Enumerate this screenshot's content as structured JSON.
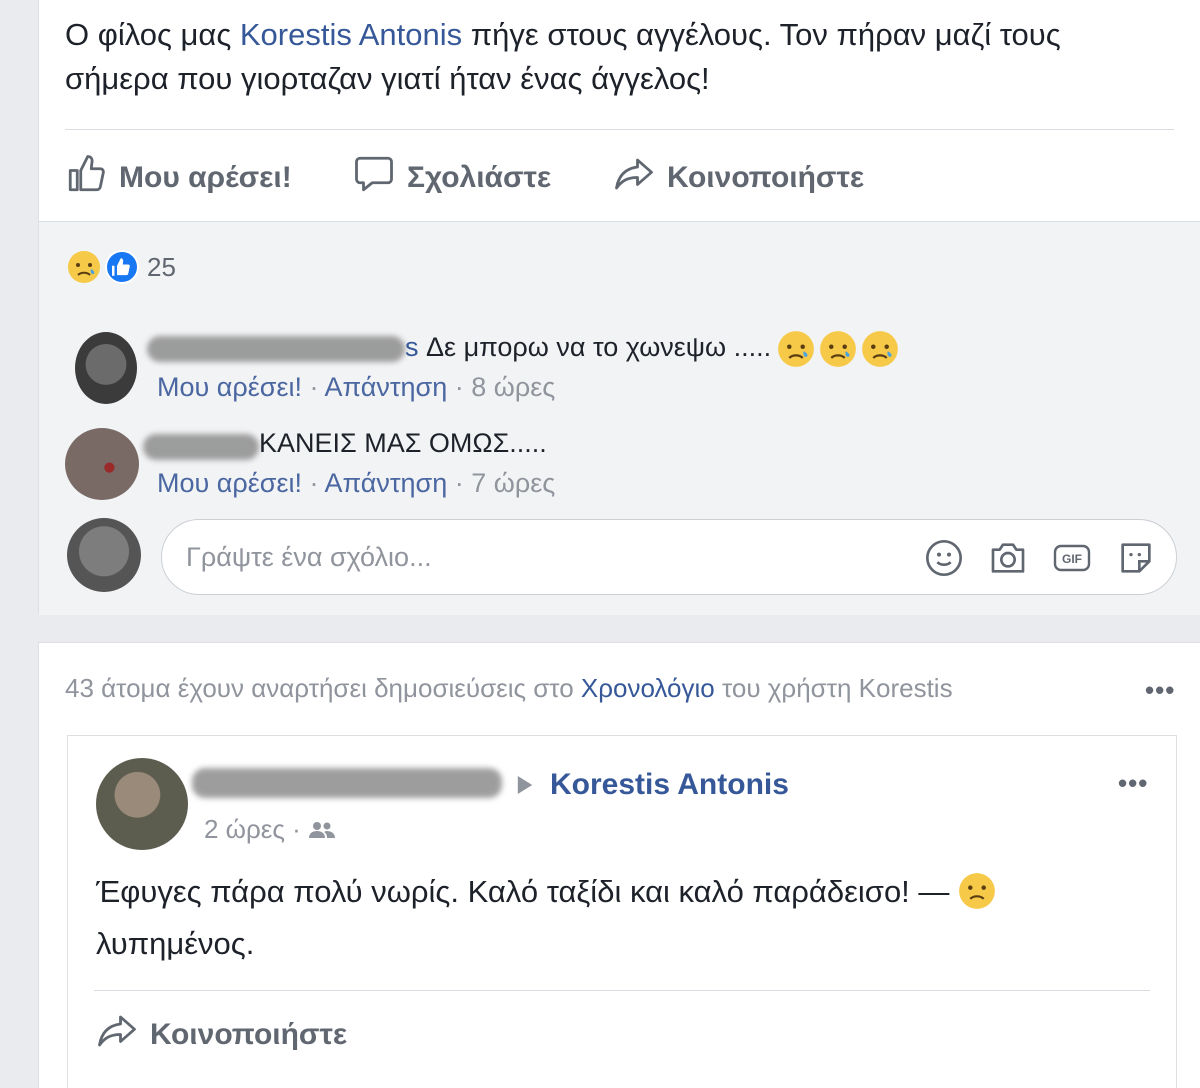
{
  "post": {
    "text_before": "Ο φίλος μας ",
    "tagged": "Korestis Antonis",
    "text_after": " πήγε στους αγγέλους. Τον πήραν μαζί τους σήμερα που γιορταζαν γιατί ήταν ένας άγγελος!"
  },
  "actions": {
    "like": "Μου αρέσει!",
    "comment": "Σχολιάστε",
    "share": "Κοινοποιήστε"
  },
  "reactions": {
    "count": "25",
    "icons": [
      "sad-emoji",
      "like-thumb"
    ]
  },
  "comments": [
    {
      "name_suffix": "s",
      "text": " Δε μπορω να το χωνεψω ..... ",
      "emoji": [
        "sad-emoji",
        "sad-emoji",
        "sad-emoji"
      ],
      "like": "Μου αρέσει!",
      "reply": "Απάντηση",
      "time": "8 ώρες"
    },
    {
      "text": "ΚΑΝΕΙΣ ΜΑΣ ΟΜΩΣ.....",
      "like": "Μου αρέσει!",
      "reply": "Απάντηση",
      "time": "7 ώρες"
    }
  ],
  "comment_box": {
    "placeholder": "Γράψτε ένα σχόλιο...",
    "icons": [
      "smiley-icon",
      "camera-icon",
      "gif-icon",
      "sticker-icon"
    ],
    "gif_label": "GIF"
  },
  "timeline": {
    "header_before": "43 άτομα έχουν αναρτήσει δημοσιεύσεις στο ",
    "header_link": "Χρονολόγιο",
    "header_after": " του χρήστη Korestis",
    "more": "•••"
  },
  "shared_post": {
    "target": "Korestis Antonis",
    "time": "2 ώρες",
    "text": "Έφυγες πάρα πολύ νωρίς. Καλό ταξίδι και καλό παράδεισο! — ",
    "feeling": "λυπημένος.",
    "share": "Κοινοποιήστε",
    "more": "•••"
  },
  "colors": {
    "link": "#365899",
    "meta": "#90949c",
    "action": "#606770",
    "like_blue": "#1877f2",
    "emoji_yellow": "#f7c948",
    "background": "#e9ebee"
  }
}
